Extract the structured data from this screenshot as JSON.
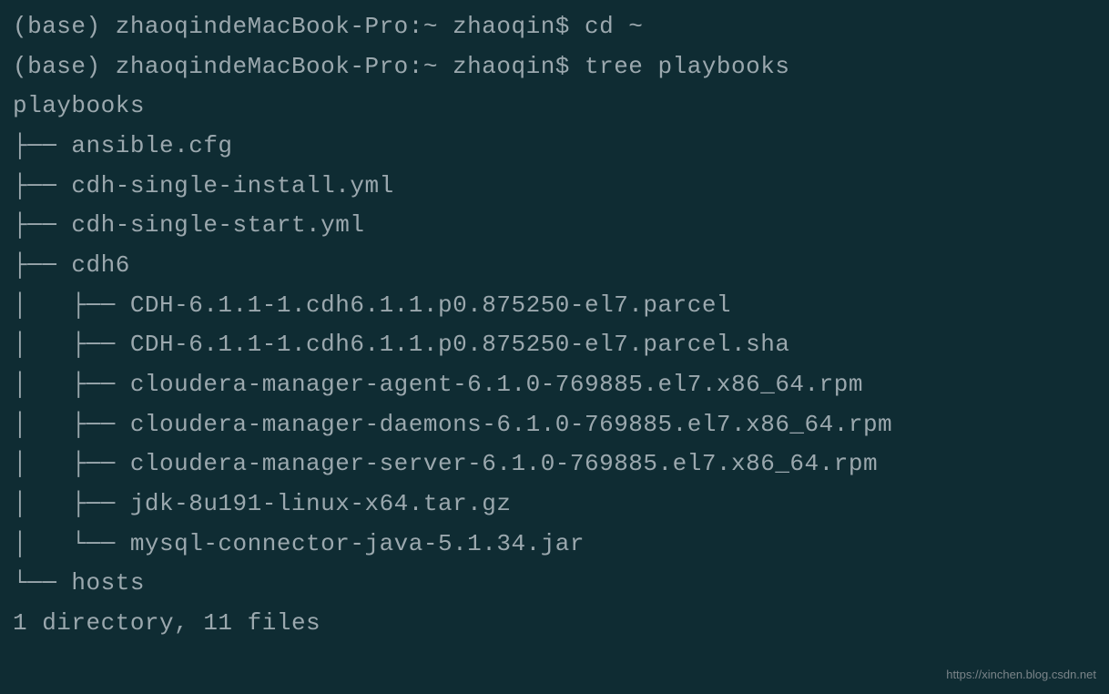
{
  "lines": {
    "l1": "(base) zhaoqindeMacBook-Pro:~ zhaoqin$ cd ~",
    "l2": "(base) zhaoqindeMacBook-Pro:~ zhaoqin$ tree playbooks",
    "l3": "playbooks",
    "l4": "├── ansible.cfg",
    "l5": "├── cdh-single-install.yml",
    "l6": "├── cdh-single-start.yml",
    "l7": "├── cdh6",
    "l8": "│   ├── CDH-6.1.1-1.cdh6.1.1.p0.875250-el7.parcel",
    "l9": "│   ├── CDH-6.1.1-1.cdh6.1.1.p0.875250-el7.parcel.sha",
    "l10": "│   ├── cloudera-manager-agent-6.1.0-769885.el7.x86_64.rpm",
    "l11": "│   ├── cloudera-manager-daemons-6.1.0-769885.el7.x86_64.rpm",
    "l12": "│   ├── cloudera-manager-server-6.1.0-769885.el7.x86_64.rpm",
    "l13": "│   ├── jdk-8u191-linux-x64.tar.gz",
    "l14": "│   └── mysql-connector-java-5.1.34.jar",
    "l15": "└── hosts",
    "l16": "",
    "l17": "1 directory, 11 files"
  },
  "watermark": "https://xinchen.blog.csdn.net"
}
